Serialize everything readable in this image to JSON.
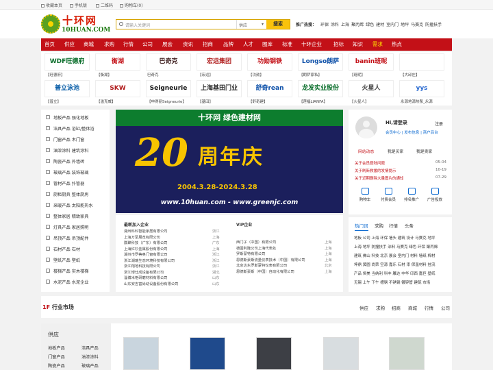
{
  "topbar": {
    "favorite": "收藏本页",
    "mobile": "手机版",
    "qrcode": "二维码",
    "cart": "购物车(0)"
  },
  "logo": {
    "cn": "十环网",
    "en": "10HUAN.COM"
  },
  "search": {
    "placeholder": "请输入关键词",
    "scope": "供应",
    "button": "搜索"
  },
  "hot": {
    "label": "推广热搜：",
    "terms": [
      "环保",
      "涂料",
      "上海",
      "聚丙烯",
      "绿色",
      "建材",
      "室内门",
      "地坪",
      "马赛克",
      "防撞扶手"
    ]
  },
  "nav": [
    "首页",
    "供应",
    "商城",
    "求购",
    "行情",
    "公司",
    "展会",
    "资讯",
    "招商",
    "品牌",
    "人才",
    "图库",
    "标准",
    "十环企业",
    "招标",
    "知识",
    "需求",
    "热点"
  ],
  "nav_highlight_index": 16,
  "brands": {
    "row1": [
      {
        "logo": "WDF旺德府",
        "name": "【旺德府】",
        "color": "#0a6e2b"
      },
      {
        "logo": "衡湖",
        "name": "【衡湖】",
        "color": "#c31017"
      },
      {
        "logo": "巴奇克",
        "name": "巴奇克",
        "color": "#3a1a1a"
      },
      {
        "logo": "宏运集团",
        "name": "【宏运】",
        "color": "#b01c1c"
      },
      {
        "logo": "功勋钢铁",
        "name": "【功勋】",
        "color": "#c31017"
      },
      {
        "logo": "Longso朗萨",
        "name": "【朗萨家私】",
        "color": "#0a4ea8"
      },
      {
        "logo": "banin班昵",
        "name": "【班昵】",
        "color": "#c31017"
      },
      {
        "logo": "",
        "name": "【大邱庄】",
        "color": "#555"
      }
    ],
    "row2": [
      {
        "logo": "普立泳池",
        "name": "【普立】",
        "color": "#0a5ea8"
      },
      {
        "logo": "SKW",
        "name": "【滥克威】",
        "color": "#b01c1c"
      },
      {
        "logo": "Seigneurie",
        "name": "【申得丽Seigneurie】",
        "color": "#111"
      },
      {
        "logo": "上海基田门业",
        "name": "【基田】",
        "color": "#333"
      },
      {
        "logo": "舒奇rean",
        "name": "【舒奇建】",
        "color": "#0a4ea8"
      },
      {
        "logo": "龙发实业股份",
        "name": "【莲福LIANFA】",
        "color": "#0a6e2b"
      },
      {
        "logo": "火星人",
        "name": "【火星人】",
        "color": "#444"
      },
      {
        "logo": "yys",
        "name": "永源地源热泵_永源",
        "color": "#2a6ad0"
      }
    ]
  },
  "categories": [
    "地板产品 强化地板",
    "洁具产品 浴缸/整体浴",
    "门窗产品 木门窗",
    "油漆涂料 建筑涂料",
    "陶瓷产品 外墙砖",
    "玻璃产品 装饰玻璃",
    "管材产品 扑管器",
    "厨柜厨具 整体厨房",
    "采暖产品 太阳能热水",
    "整体家居 精致家具",
    "灯具产品 家居照明",
    "吊顶产品 吊顶配件",
    "石材产品 石材",
    "壁纸产品 壁纸",
    "楼梯产品 实木楼梯",
    "水泥产品 水泥企业"
  ],
  "banner": {
    "top": "十环网 绿色建材网",
    "big": "20",
    "word": "周年庆",
    "dates": "2004.3.28-2024.3.28",
    "url": "www.10huan.com - www.greenjc.com"
  },
  "new_firms": {
    "title": "最新加入企业",
    "rows": [
      {
        "name": "湖州科科智能家居有限公司",
        "region": "浙江"
      },
      {
        "name": "上海万至展览有限公司",
        "region": "上海"
      },
      {
        "name": "群聚科技（广东）有限公司",
        "region": "广东"
      },
      {
        "name": "上海红杉金属股份有限公司",
        "region": "上海"
      },
      {
        "name": "湖州市罗蒂奥门窗有限公司",
        "region": "浙江"
      },
      {
        "name": "浙江湖瑞生态环境科技有限公司",
        "region": "浙江"
      },
      {
        "name": "浙江翔地科技有限公司",
        "region": "浙江"
      },
      {
        "name": "浙江博仕成设备有限公司",
        "region": "湖北"
      },
      {
        "name": "淄博米格研磨材料有限公司",
        "region": "山东"
      },
      {
        "name": "山东安吉富尚动设备股份有限公司",
        "region": "山东"
      }
    ]
  },
  "vip_firms": {
    "title": "VIP企业",
    "rows": [
      {
        "name": "西门子（中国）有限公司",
        "region": "上海"
      },
      {
        "name": "德固利隆公司上海代表处",
        "region": "上海"
      },
      {
        "name": "罗斯蒙特有限公司",
        "region": "上海"
      },
      {
        "name": "恩德斯豪斯流量仪表技术（中国）有限公司",
        "region": "上海"
      },
      {
        "name": "北京达东罗斯蒙特仪表有限公司",
        "region": "北京"
      },
      {
        "name": "恩德斯豪斯（中国）自动化有限公司",
        "region": "上海"
      }
    ]
  },
  "user": {
    "greeting": "Hi,请登录",
    "register": "注册",
    "links": "会员中心 | 发布信息 | 商户后台",
    "tabs": [
      "网站动态",
      "我是买家",
      "我是卖家"
    ],
    "notices": [
      {
        "text": "关于会员登陆问题",
        "date": "05-04"
      },
      {
        "text": "关于刷新救援的发情提示",
        "date": "10-19"
      },
      {
        "text": "关于近期删除大量图片的通知",
        "date": "07-29"
      }
    ],
    "quick": [
      "购物车",
      "付费会员",
      "排名推广",
      "广告投放"
    ]
  },
  "hotword": {
    "tabs": [
      "热门词",
      "求购",
      "行情",
      "头条"
    ],
    "lines": [
      "地板 公司 上海 环保 墙头 建筑 设计 马赛克 地坪",
      "上海 地坪 防撞扶手 涂料 马赛克 绿色 环保 聚丙烯",
      "建筑 佛山 科技 北京 展会 室内门 材料 墙纸 棉材",
      "坤鼎 黄圆 尚荣 空源 嘉乐 石材 漆 保温材料 挂流",
      "产品 恒美 当纳利 科丰 雕达 中华 印西 嘉巨 壁纸",
      "无锡 上午 下午 槽钢 不锈钢 镀锌管 建筑 市场"
    ]
  },
  "floor": {
    "title_num": "1F",
    "title": "行业市场",
    "links": [
      "供应",
      "求购",
      "招商",
      "商城",
      "行情",
      "公司"
    ],
    "side_title": "供应",
    "side_items": [
      "地板产品",
      "洁具产品",
      "门窗产品",
      "油漆涂料",
      "陶瓷产品",
      "玻璃产品"
    ],
    "thumb_colors": [
      "#c9d5de",
      "#1f4a8c",
      "#3d3f45",
      "#d8dde0",
      "#cfd8cf",
      "#e9ebed"
    ]
  }
}
